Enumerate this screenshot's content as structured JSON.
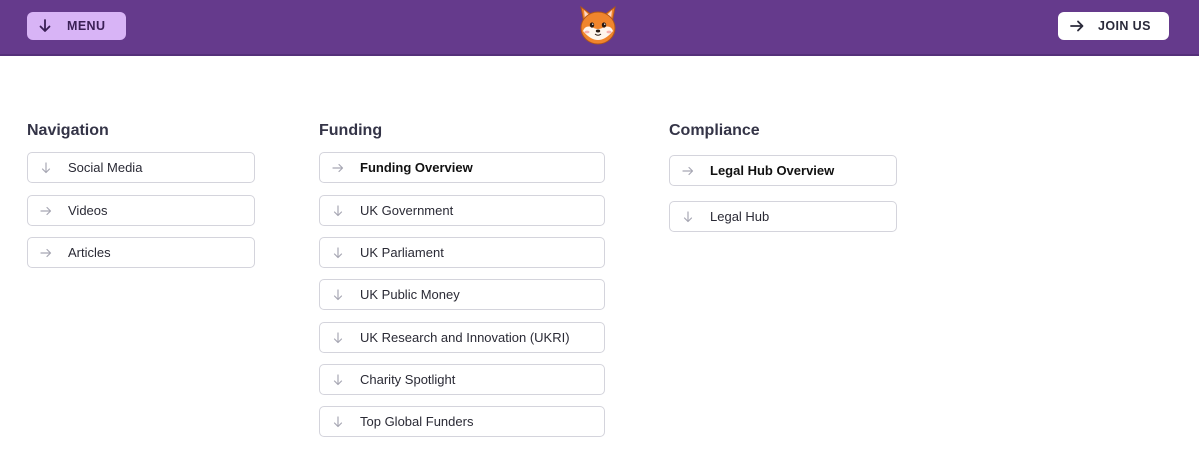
{
  "header": {
    "menu_label": "MENU",
    "join_label": "JOIN US",
    "logo_icon": "shiba-dog-face-icon",
    "colors": {
      "bar": "#653a8c",
      "menu_bg": "#d8b4f6"
    }
  },
  "columns": [
    {
      "title": "Navigation",
      "items": [
        {
          "label": "Social Media",
          "icon": "arrow-down-icon"
        },
        {
          "label": "Videos",
          "icon": "arrow-right-icon"
        },
        {
          "label": "Articles",
          "icon": "arrow-right-icon"
        }
      ]
    },
    {
      "title": "Funding",
      "items": [
        {
          "label": "Funding Overview",
          "icon": "arrow-right-icon"
        },
        {
          "label": "UK Government",
          "icon": "arrow-down-icon"
        },
        {
          "label": "UK Parliament",
          "icon": "arrow-down-icon"
        },
        {
          "label": "UK Public Money",
          "icon": "arrow-down-icon"
        },
        {
          "label": "UK Research and Innovation (UKRI)",
          "icon": "arrow-down-icon"
        },
        {
          "label": "Charity Spotlight",
          "icon": "arrow-down-icon"
        },
        {
          "label": "Top Global Funders",
          "icon": "arrow-down-icon"
        }
      ]
    },
    {
      "title": "Compliance",
      "items": [
        {
          "label": "Legal Hub Overview",
          "icon": "arrow-right-icon"
        },
        {
          "label": "Legal Hub",
          "icon": "arrow-down-icon"
        }
      ]
    }
  ]
}
